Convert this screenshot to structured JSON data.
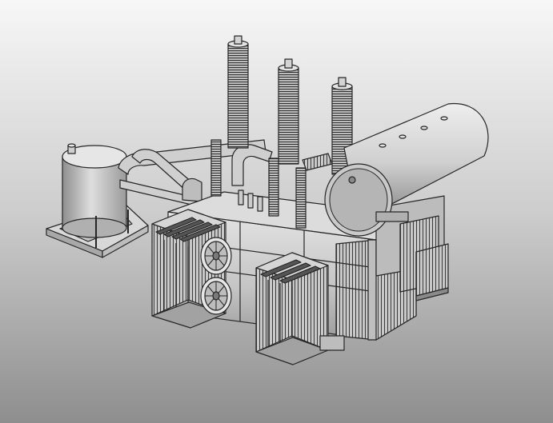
{
  "scene": {
    "subject": "power-transformer-3d-model",
    "icons": [
      "conservator-tank-icon",
      "hv-bushing-icon",
      "radiator-bank-icon",
      "cooling-fan-icon",
      "breather-tank-icon"
    ],
    "colors": {
      "background_top": "#f7f7f7",
      "background_bottom": "#8e8e8e",
      "model_fill": "#d0d0d0",
      "model_shade": "#a9a9a9",
      "model_dark": "#7a7a7a",
      "edge": "#262626"
    }
  }
}
